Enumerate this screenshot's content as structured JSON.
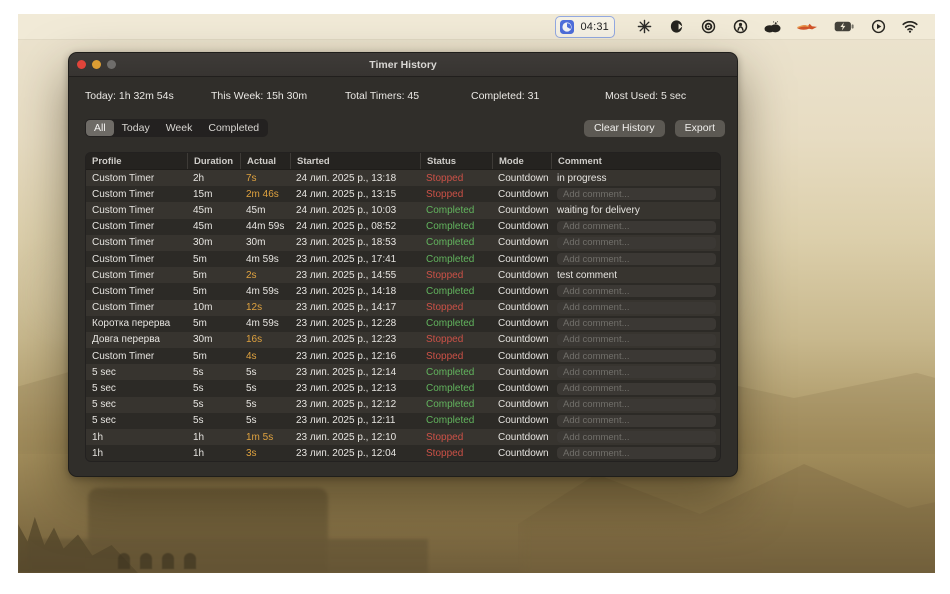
{
  "menu_bar": {
    "clock_widget": {
      "time": "04:31"
    },
    "icons": [
      "sparkle-icon",
      "cat-icon",
      "record-icon",
      "broadcast-icon",
      "cloud-icon",
      "fox-icon",
      "battery-charging-icon",
      "play-circle-icon",
      "wifi-icon"
    ]
  },
  "window": {
    "title": "Timer History",
    "stats": [
      "Today: 1h 32m 54s",
      "This Week: 15h 30m",
      "Total Timers: 45",
      "Completed: 31",
      "Most Used: 5 sec"
    ],
    "filters": {
      "options": [
        "All",
        "Today",
        "Week",
        "Completed"
      ],
      "selected": "All"
    },
    "buttons": {
      "clear_history": "Clear History",
      "export": "Export"
    },
    "table": {
      "columns": [
        "Profile",
        "Duration",
        "Actual",
        "Started",
        "Status",
        "Mode",
        "Comment"
      ],
      "comment_placeholder": "Add comment...",
      "rows": [
        {
          "profile": "Custom Timer",
          "duration": "2h",
          "actual": "7s",
          "started": "24 лип. 2025 р., 13:18",
          "status": "Stopped",
          "mode": "Countdown",
          "comment": "in progress"
        },
        {
          "profile": "Custom Timer",
          "duration": "15m",
          "actual": "2m 46s",
          "started": "24 лип. 2025 р., 13:15",
          "status": "Stopped",
          "mode": "Countdown",
          "comment": ""
        },
        {
          "profile": "Custom Timer",
          "duration": "45m",
          "actual": "45m",
          "started": "24 лип. 2025 р., 10:03",
          "status": "Completed",
          "mode": "Countdown",
          "comment": "waiting for delivery"
        },
        {
          "profile": "Custom Timer",
          "duration": "45m",
          "actual": "44m 59s",
          "started": "24 лип. 2025 р., 08:52",
          "status": "Completed",
          "mode": "Countdown",
          "comment": ""
        },
        {
          "profile": "Custom Timer",
          "duration": "30m",
          "actual": "30m",
          "started": "23 лип. 2025 р., 18:53",
          "status": "Completed",
          "mode": "Countdown",
          "comment": ""
        },
        {
          "profile": "Custom Timer",
          "duration": "5m",
          "actual": "4m 59s",
          "started": "23 лип. 2025 р., 17:41",
          "status": "Completed",
          "mode": "Countdown",
          "comment": ""
        },
        {
          "profile": "Custom Timer",
          "duration": "5m",
          "actual": "2s",
          "started": "23 лип. 2025 р., 14:55",
          "status": "Stopped",
          "mode": "Countdown",
          "comment": "test comment"
        },
        {
          "profile": "Custom Timer",
          "duration": "5m",
          "actual": "4m 59s",
          "started": "23 лип. 2025 р., 14:18",
          "status": "Completed",
          "mode": "Countdown",
          "comment": ""
        },
        {
          "profile": "Custom Timer",
          "duration": "10m",
          "actual": "12s",
          "started": "23 лип. 2025 р., 14:17",
          "status": "Stopped",
          "mode": "Countdown",
          "comment": ""
        },
        {
          "profile": "Коротка перерва",
          "duration": "5m",
          "actual": "4m 59s",
          "started": "23 лип. 2025 р., 12:28",
          "status": "Completed",
          "mode": "Countdown",
          "comment": ""
        },
        {
          "profile": "Довга перерва",
          "duration": "30m",
          "actual": "16s",
          "started": "23 лип. 2025 р., 12:23",
          "status": "Stopped",
          "mode": "Countdown",
          "comment": ""
        },
        {
          "profile": "Custom Timer",
          "duration": "5m",
          "actual": "4s",
          "started": "23 лип. 2025 р., 12:16",
          "status": "Stopped",
          "mode": "Countdown",
          "comment": ""
        },
        {
          "profile": "5 sec",
          "duration": "5s",
          "actual": "5s",
          "started": "23 лип. 2025 р., 12:14",
          "status": "Completed",
          "mode": "Countdown",
          "comment": ""
        },
        {
          "profile": "5 sec",
          "duration": "5s",
          "actual": "5s",
          "started": "23 лип. 2025 р., 12:13",
          "status": "Completed",
          "mode": "Countdown",
          "comment": ""
        },
        {
          "profile": "5 sec",
          "duration": "5s",
          "actual": "5s",
          "started": "23 лип. 2025 р., 12:12",
          "status": "Completed",
          "mode": "Countdown",
          "comment": ""
        },
        {
          "profile": "5 sec",
          "duration": "5s",
          "actual": "5s",
          "started": "23 лип. 2025 р., 12:11",
          "status": "Completed",
          "mode": "Countdown",
          "comment": ""
        },
        {
          "profile": "1h",
          "duration": "1h",
          "actual": "1m 5s",
          "started": "23 лип. 2025 р., 12:10",
          "status": "Stopped",
          "mode": "Countdown",
          "comment": ""
        },
        {
          "profile": "1h",
          "duration": "1h",
          "actual": "3s",
          "started": "23 лип. 2025 р., 12:04",
          "status": "Stopped",
          "mode": "Countdown",
          "comment": ""
        }
      ]
    }
  },
  "colors": {
    "stopped": "#cc5147",
    "completed": "#62b45e",
    "warn": "#dfa23f",
    "accent": "#4d6ddb"
  }
}
